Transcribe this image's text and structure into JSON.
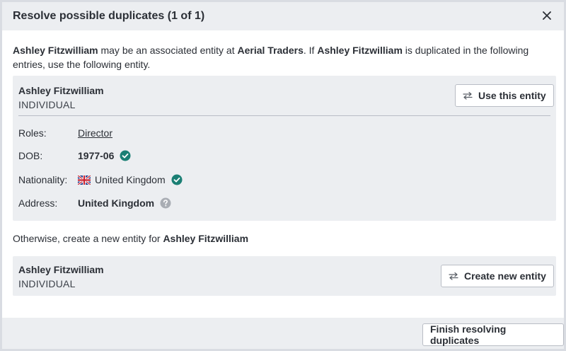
{
  "header": {
    "title": "Resolve possible duplicates (1 of 1)",
    "close_icon": "close-icon"
  },
  "intro": {
    "part1": "Ashley Fitzwilliam",
    "part2": " may be an associated entity at ",
    "part3": "Aerial Traders",
    "part4": ". If ",
    "part5": "Ashley Fitzwilliam",
    "part6": " is duplicated in the following entries, use the following entity."
  },
  "existing_entity": {
    "name": "Ashley Fitzwilliam",
    "type": "INDIVIDUAL",
    "use_button_label": "Use this entity",
    "details": {
      "roles_label": "Roles:",
      "roles_value": "Director",
      "dob_label": "DOB:",
      "dob_value": "1977-06",
      "nationality_label": "Nationality:",
      "nationality_value": "United Kingdom",
      "address_label": "Address:",
      "address_value": "United Kingdom"
    }
  },
  "otherwise": {
    "text": "Otherwise, create a new entity for ",
    "name": "Ashley Fitzwilliam"
  },
  "new_entity": {
    "name": "Ashley Fitzwilliam",
    "type": "INDIVIDUAL",
    "create_button_label": "Create new entity"
  },
  "footer": {
    "finish_button_label": "Finish resolving duplicates"
  },
  "colors": {
    "verified": "#1a7f74",
    "unknown": "#a9adb4",
    "panel": "#eceef1",
    "border": "#b9bdc5"
  }
}
